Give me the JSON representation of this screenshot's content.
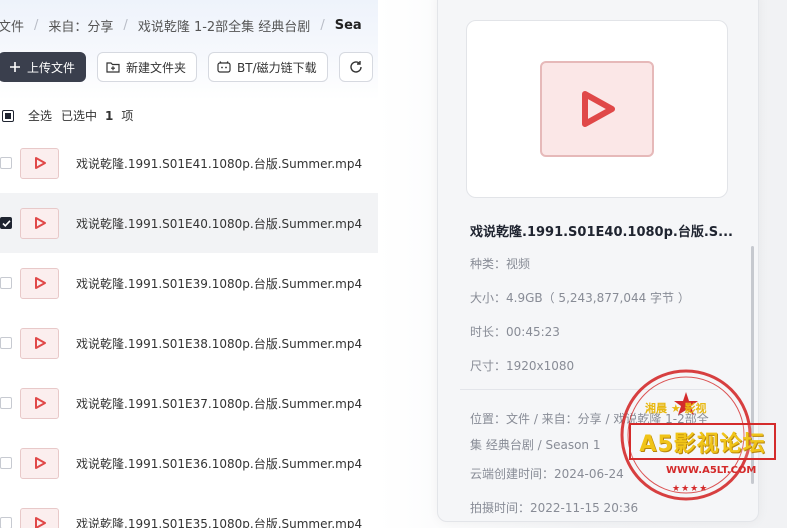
{
  "breadcrumb": {
    "items": [
      "文件",
      "来自：分享",
      "戏说乾隆 1-2部全集 经典台剧",
      "Sea"
    ],
    "separator": "/"
  },
  "toolbar": {
    "upload_label": "上传文件",
    "new_folder_label": "新建文件夹",
    "bt_label": "BT/磁力链下载"
  },
  "selection": {
    "select_all_label": "全选",
    "selected_prefix": "已选中",
    "selected_count": "1",
    "selected_suffix": "项"
  },
  "files": [
    {
      "name": "戏说乾隆.1991.S01E41.1080p.台版.Summer.mp4",
      "selected": false
    },
    {
      "name": "戏说乾隆.1991.S01E40.1080p.台版.Summer.mp4",
      "selected": true
    },
    {
      "name": "戏说乾隆.1991.S01E39.1080p.台版.Summer.mp4",
      "selected": false
    },
    {
      "name": "戏说乾隆.1991.S01E38.1080p.台版.Summer.mp4",
      "selected": false
    },
    {
      "name": "戏说乾隆.1991.S01E37.1080p.台版.Summer.mp4",
      "selected": false
    },
    {
      "name": "戏说乾隆.1991.S01E36.1080p.台版.Summer.mp4",
      "selected": false
    },
    {
      "name": "戏说乾隆.1991.S01E35.1080p.台版.Summer.mp4",
      "selected": false
    }
  ],
  "detail": {
    "title": "戏说乾隆.1991.S01E40.1080p.台版.S...",
    "type": "种类：视频",
    "size": "大小：4.9GB（ 5,243,877,044 字节 ）",
    "duration": "时长：00:45:23",
    "dimensions": "尺寸：1920x1080",
    "location": "位置：文件 / 来自：分享 / 戏说乾隆 1-2部全集 经典台剧 / Season 1",
    "created": "云端创建时间：2024-06-24",
    "shot": "拍摄时间：2022-11-15 20:36"
  },
  "watermark": {
    "top_text": "湘晨 ★ 影视",
    "main_text": "A5影视论坛",
    "url": "WWW.A5LT.COM",
    "stars": "★★★★",
    "color": "#d42b2b"
  },
  "colors": {
    "accent_dark": "#3a3f4d",
    "play_red": "#e04848",
    "thumb_bg": "#fbeeee"
  }
}
